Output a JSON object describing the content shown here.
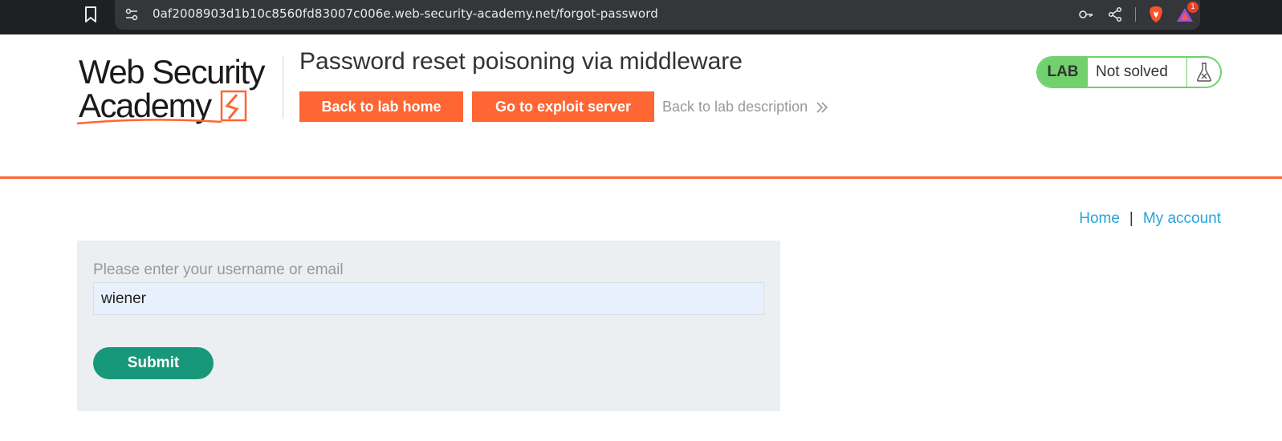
{
  "browser": {
    "url": "0af2008903d1b10c8560fd83007c006e.web-security-academy.net/forgot-password",
    "notification_count": "1"
  },
  "header": {
    "logo_line1": "Web Security",
    "logo_line2": "Academy",
    "title": "Password reset poisoning via middleware",
    "back_home_label": "Back to lab home",
    "exploit_label": "Go to exploit server",
    "back_description_label": "Back to lab description",
    "lab_badge": "LAB",
    "lab_status": "Not solved"
  },
  "nav": {
    "home": "Home",
    "separator": "|",
    "account": "My account"
  },
  "form": {
    "label": "Please enter your username or email",
    "value": "wiener",
    "submit_label": "Submit"
  },
  "colors": {
    "accent": "#ff6633",
    "lab_green": "#70d16d",
    "submit": "#18987a",
    "link": "#29a3d9"
  }
}
